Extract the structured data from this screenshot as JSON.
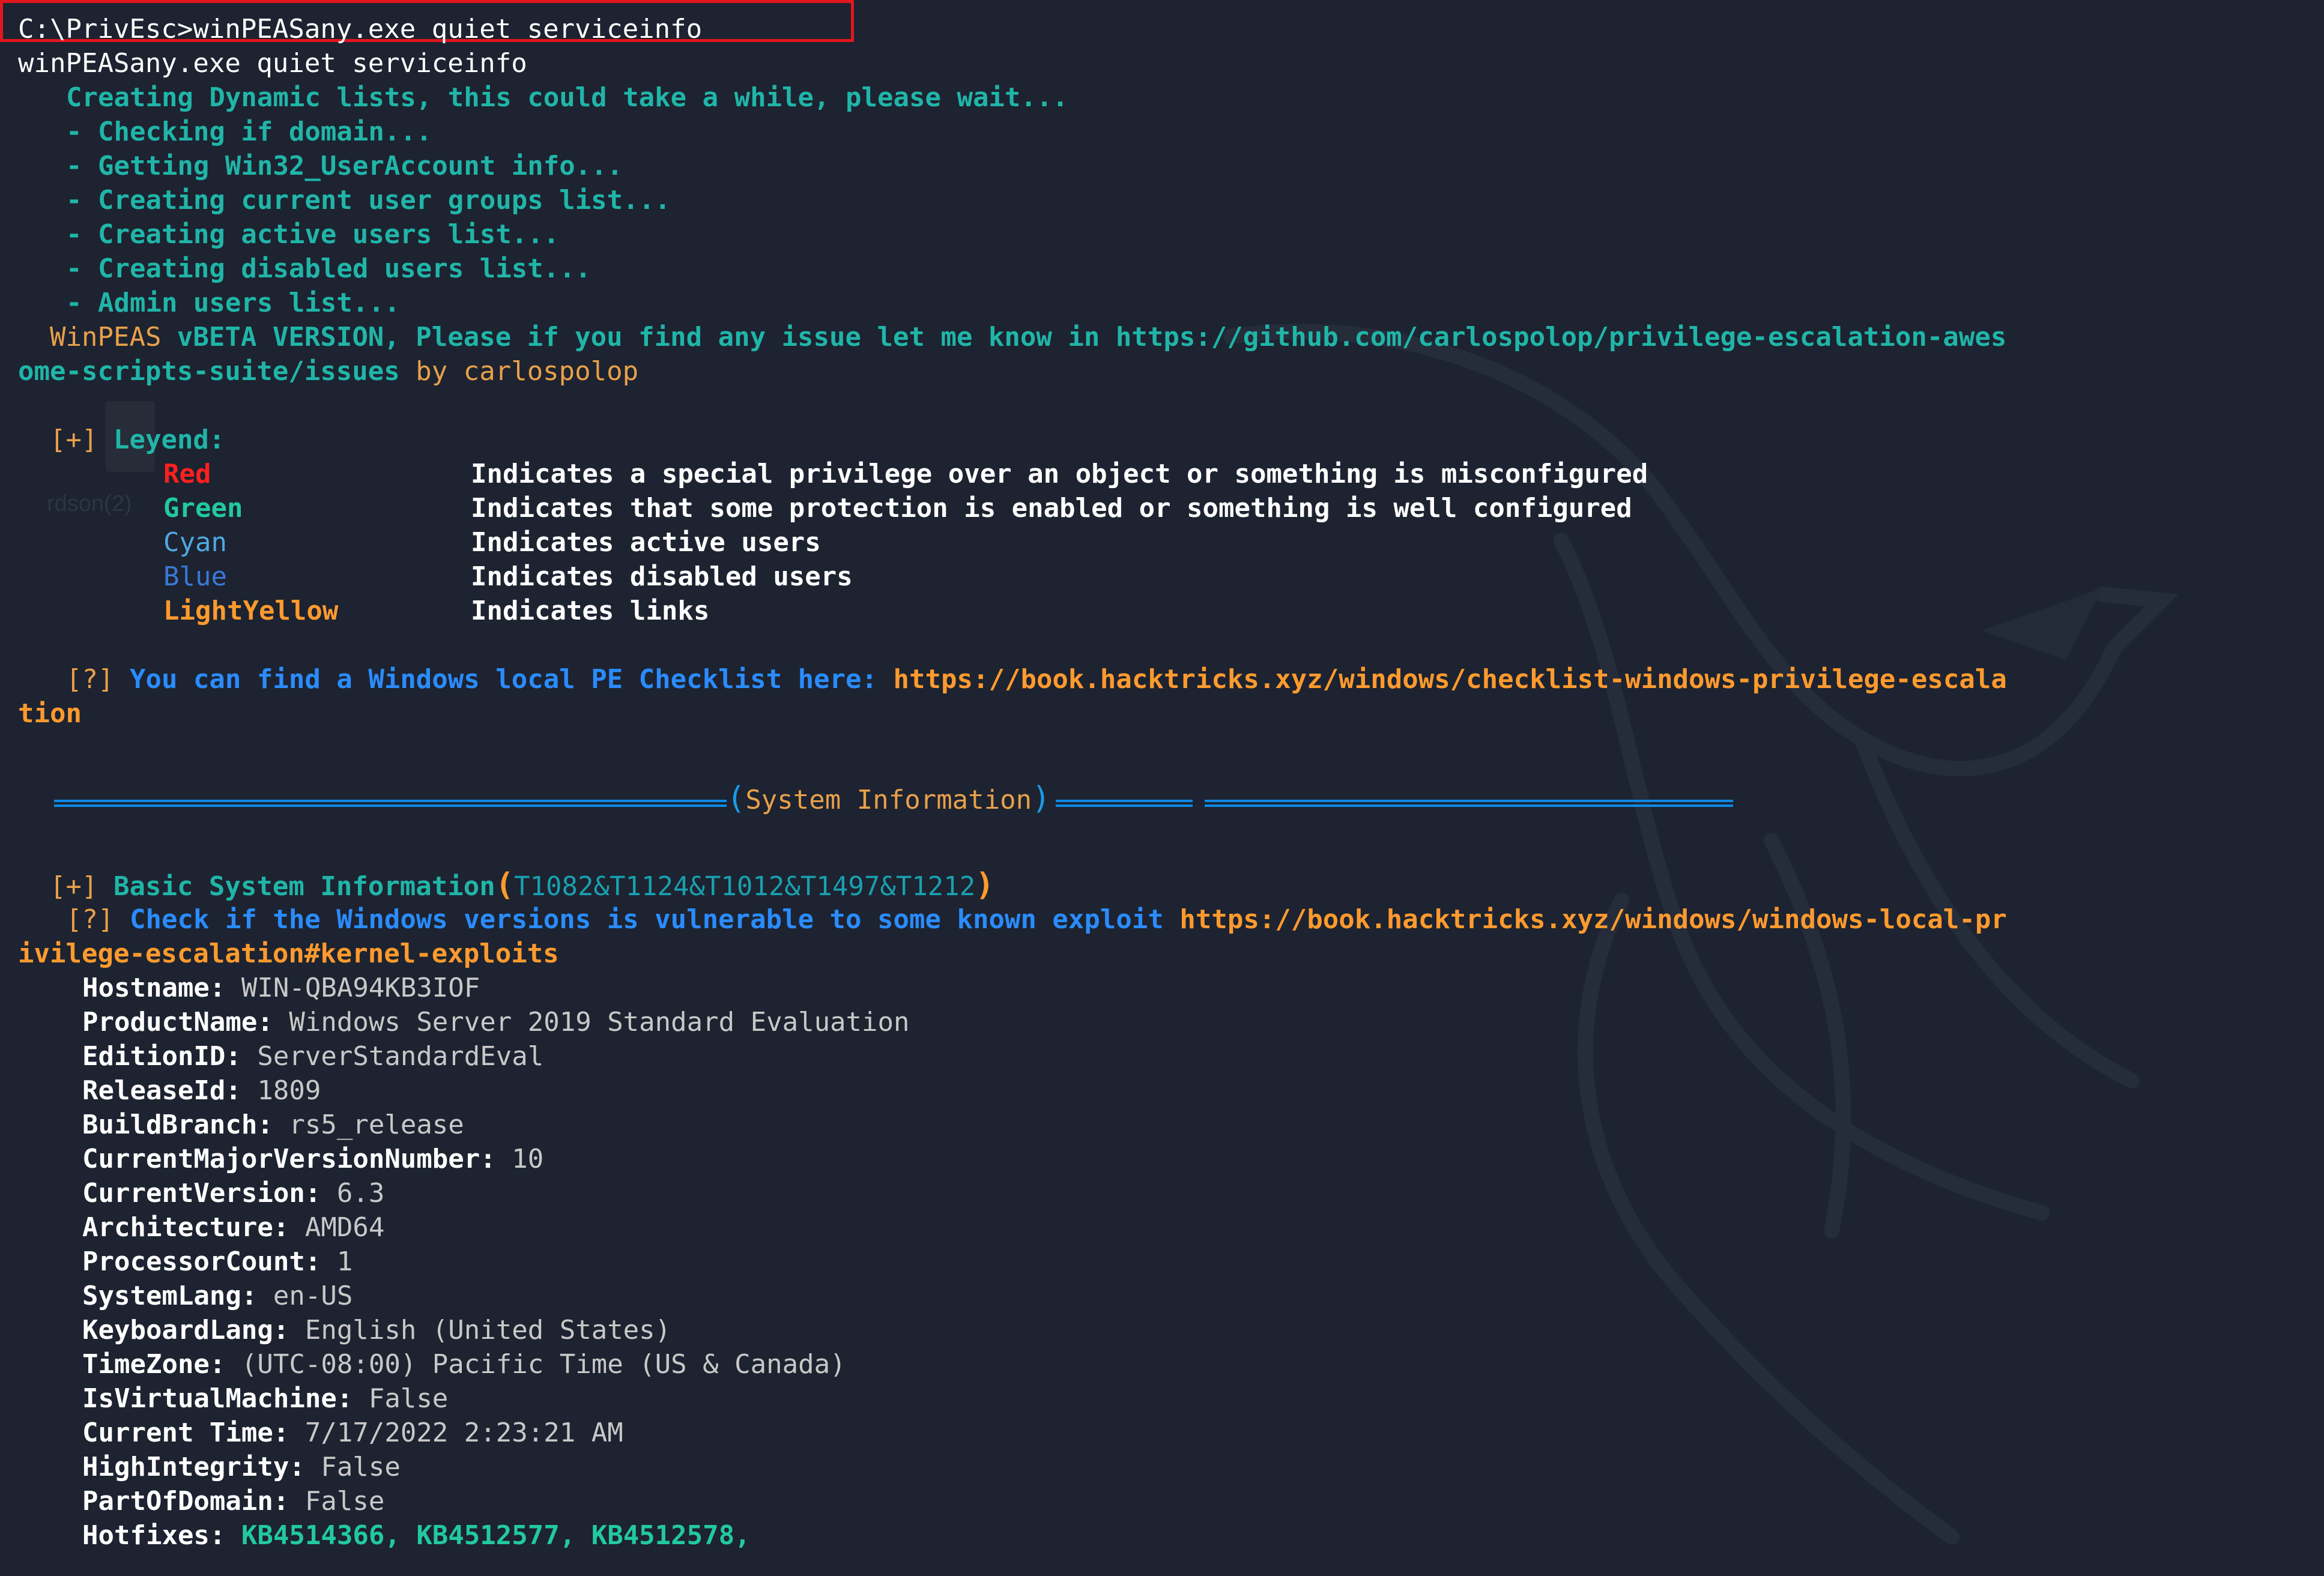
{
  "command": "C:\\PrivEsc>winPEASany.exe quiet serviceinfo",
  "echo": "winPEASany.exe quiet serviceinfo",
  "init": {
    "creating": "Creating Dynamic lists, this could take a while, please wait...",
    "steps": [
      "- Checking if domain...",
      "- Getting Win32_UserAccount info...",
      "- Creating current user groups list...",
      "- Creating active users list...",
      "- Creating disabled users list...",
      "- Admin users list..."
    ]
  },
  "banner": {
    "winpeas": "WinPEAS",
    "version_text": " vBETA VERSION, Please if you find any issue let me know in https://github.com/carlospolop/privilege-escalation-awes",
    "version_text_cont": "ome-scripts-suite/issues",
    "by": " by carlospolop"
  },
  "legend": {
    "marker": "[+]",
    "title": "Leyend:",
    "items": [
      {
        "name": "Red",
        "desc": "Indicates a special privilege over an object or something is misconfigured"
      },
      {
        "name": "Green",
        "desc": "Indicates that some protection is enabled or something is well configured"
      },
      {
        "name": "Cyan",
        "desc": "Indicates active users"
      },
      {
        "name": "Blue",
        "desc": "Indicates disabled users"
      },
      {
        "name": "LightYellow",
        "desc": "Indicates links"
      }
    ]
  },
  "checklist": {
    "marker": "[?]",
    "text": "You can find a Windows local PE Checklist here:",
    "link": "https://book.hacktricks.xyz/windows/checklist-windows-privilege-escala",
    "link_cont": "tion"
  },
  "section": {
    "open": "(",
    "label": "System Information",
    "close": ")"
  },
  "basic": {
    "marker": "[+]",
    "title": "Basic System Information",
    "tags": "(T1082&T1124&T1012&T1497&T1212)",
    "check_marker": "[?]",
    "check_text": "Check if the Windows versions is vulnerable to some known exploit",
    "check_link": "https://book.hacktricks.xyz/windows/windows-local-pr",
    "check_link_cont": "ivilege-escalation#kernel-exploits"
  },
  "sysinfo": [
    {
      "key": "Hostname:",
      "value": "WIN-QBA94KB3IOF"
    },
    {
      "key": "ProductName:",
      "value": "Windows Server 2019 Standard Evaluation"
    },
    {
      "key": "EditionID:",
      "value": "ServerStandardEval"
    },
    {
      "key": "ReleaseId:",
      "value": "1809"
    },
    {
      "key": "BuildBranch:",
      "value": "rs5_release"
    },
    {
      "key": "CurrentMajorVersionNumber:",
      "value": "10"
    },
    {
      "key": "CurrentVersion:",
      "value": "6.3"
    },
    {
      "key": "Architecture:",
      "value": "AMD64"
    },
    {
      "key": "ProcessorCount:",
      "value": "1"
    },
    {
      "key": "SystemLang:",
      "value": "en-US"
    },
    {
      "key": "KeyboardLang:",
      "value": "English (United States)"
    },
    {
      "key": "TimeZone:",
      "value": "(UTC-08:00) Pacific Time (US & Canada)"
    },
    {
      "key": "IsVirtualMachine:",
      "value": "False"
    },
    {
      "key": "Current Time:",
      "value": "7/17/2022 2:23:21 AM"
    },
    {
      "key": "HighIntegrity:",
      "value": "False"
    },
    {
      "key": "PartOfDomain:",
      "value": "False"
    }
  ],
  "hotfixes": {
    "key": "Hotfixes:",
    "value": "KB4514366, KB4512577, KB4512578,"
  },
  "ghost": "rdson(2)"
}
